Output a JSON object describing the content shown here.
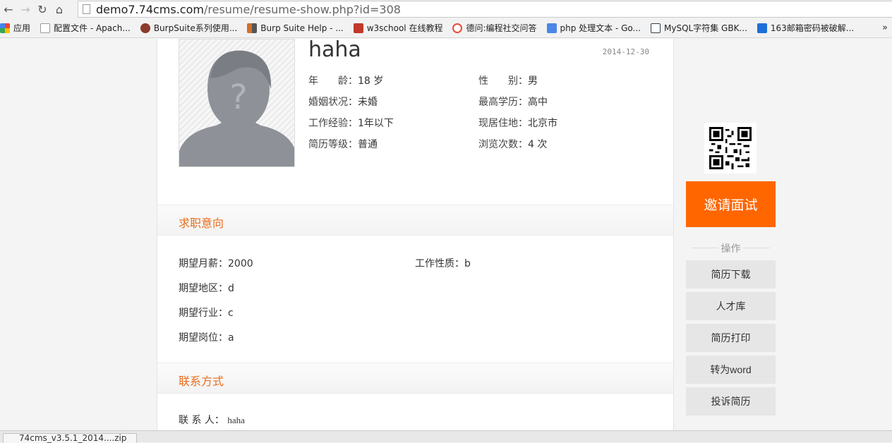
{
  "browser": {
    "url_domain": "demo7.74cms.com",
    "url_path": "/resume/resume-show.php?id=308",
    "bookmarks": [
      {
        "label": "应用",
        "icon": "apps-grid-icon",
        "color": "#e04b30"
      },
      {
        "label": "配置文件 - Apach...",
        "icon": "page-icon",
        "color": "#ffffff"
      },
      {
        "label": "BurpSuite系列使用...",
        "icon": "burp-icon",
        "color": "#8b3b2b"
      },
      {
        "label": "Burp Suite Help - ...",
        "icon": "burp-help-icon",
        "color": "#d0702a"
      },
      {
        "label": "w3school 在线教程",
        "icon": "w3school-icon",
        "color": "#c0392b"
      },
      {
        "label": "德问:编程社交问答",
        "icon": "dewen-icon",
        "color": "#e74c3c"
      },
      {
        "label": "php 处理文本 - Go...",
        "icon": "google-icon",
        "color": "#4a86e8"
      },
      {
        "label": "MySQL字符集 GBK...",
        "icon": "mysql-icon",
        "color": "#2c3e50"
      },
      {
        "label": "163邮箱密码被破解...",
        "icon": "zhihu-icon",
        "color": "#1e6fd9"
      }
    ],
    "more": "»"
  },
  "resume": {
    "name": "haha",
    "date": "2014-12-30",
    "basic": [
      {
        "label": "年　　龄：",
        "value": "18 岁"
      },
      {
        "label": "性　　别：",
        "value": "男"
      },
      {
        "label": "婚姻状况：",
        "value": "未婚"
      },
      {
        "label": "最高学历：",
        "value": "高中"
      },
      {
        "label": "工作经验：",
        "value": "1年以下"
      },
      {
        "label": "现居住地：",
        "value": "北京市"
      },
      {
        "label": "简历等级：",
        "value": "普通"
      },
      {
        "label": "浏览次数：",
        "value": "4 次"
      }
    ],
    "intent_title": "求职意向",
    "intent": [
      {
        "label": "期望月薪：",
        "value": "2000"
      },
      {
        "label": "工作性质：",
        "value": "b"
      },
      {
        "label": "期望地区：",
        "value": "d"
      },
      {
        "label": "期望行业：",
        "value": "c"
      },
      {
        "label": "期望岗位：",
        "value": "a"
      }
    ],
    "contact_title": "联系方式",
    "contact": [
      {
        "label": "联 系 人：",
        "value": "haha"
      }
    ]
  },
  "sidebar": {
    "invite_label": "邀请面试",
    "ops_title": "操作",
    "ops": [
      "简历下载",
      "人才库",
      "简历打印",
      "转为word",
      "投诉简历"
    ]
  },
  "downloads": {
    "item": "74cms_v3.5.1_2014....zip"
  }
}
